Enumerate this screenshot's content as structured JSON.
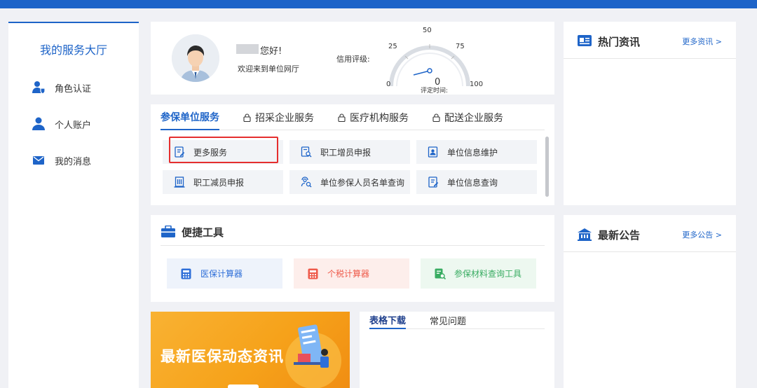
{
  "sidebar": {
    "title": "我的服务大厅",
    "items": [
      {
        "label": "角色认证",
        "icon": "user-shield-icon"
      },
      {
        "label": "个人账户",
        "icon": "user-icon"
      },
      {
        "label": "我的消息",
        "icon": "envelope-icon"
      }
    ]
  },
  "user": {
    "greeting": "您好!",
    "welcome": "欢迎来到单位网厅",
    "credit_label": "信用评级:",
    "gauge": {
      "ticks": [
        "0",
        "25",
        "50",
        "75",
        "100"
      ],
      "value": "0",
      "time_label": "评定时间:"
    }
  },
  "services": {
    "tabs": [
      {
        "label": "参保单位服务",
        "locked": false
      },
      {
        "label": "招采企业服务",
        "locked": true
      },
      {
        "label": "医疗机构服务",
        "locked": true
      },
      {
        "label": "配送企业服务",
        "locked": true
      }
    ],
    "buttons": [
      {
        "label": "更多服务",
        "icon": "edit-document-icon"
      },
      {
        "label": "职工增员申报",
        "icon": "search-document-icon"
      },
      {
        "label": "单位信息维护",
        "icon": "profile-card-icon"
      },
      {
        "label": "职工减员申报",
        "icon": "building-icon"
      },
      {
        "label": "单位参保人员名单查询",
        "icon": "people-search-icon"
      },
      {
        "label": "单位信息查询",
        "icon": "edit-document-icon"
      }
    ]
  },
  "tools": {
    "title": "便捷工具",
    "items": [
      {
        "label": "医保计算器",
        "color": "#2f6fd8",
        "bg": "#eef3fb"
      },
      {
        "label": "个税计算器",
        "color": "#ee5a4a",
        "bg": "#fdeeeb"
      },
      {
        "label": "参保材料查询工具",
        "color": "#39ac62",
        "bg": "#edf8f0"
      }
    ]
  },
  "banner": {
    "title": "最新医保动态资讯"
  },
  "downloads": {
    "tabs": [
      "表格下载",
      "常见问题"
    ]
  },
  "news": {
    "title": "热门资讯",
    "more": "更多资讯 >"
  },
  "notice": {
    "title": "最新公告",
    "more": "更多公告 >"
  },
  "colors": {
    "primary": "#1e64c8",
    "highlight": "#e52e2e"
  }
}
